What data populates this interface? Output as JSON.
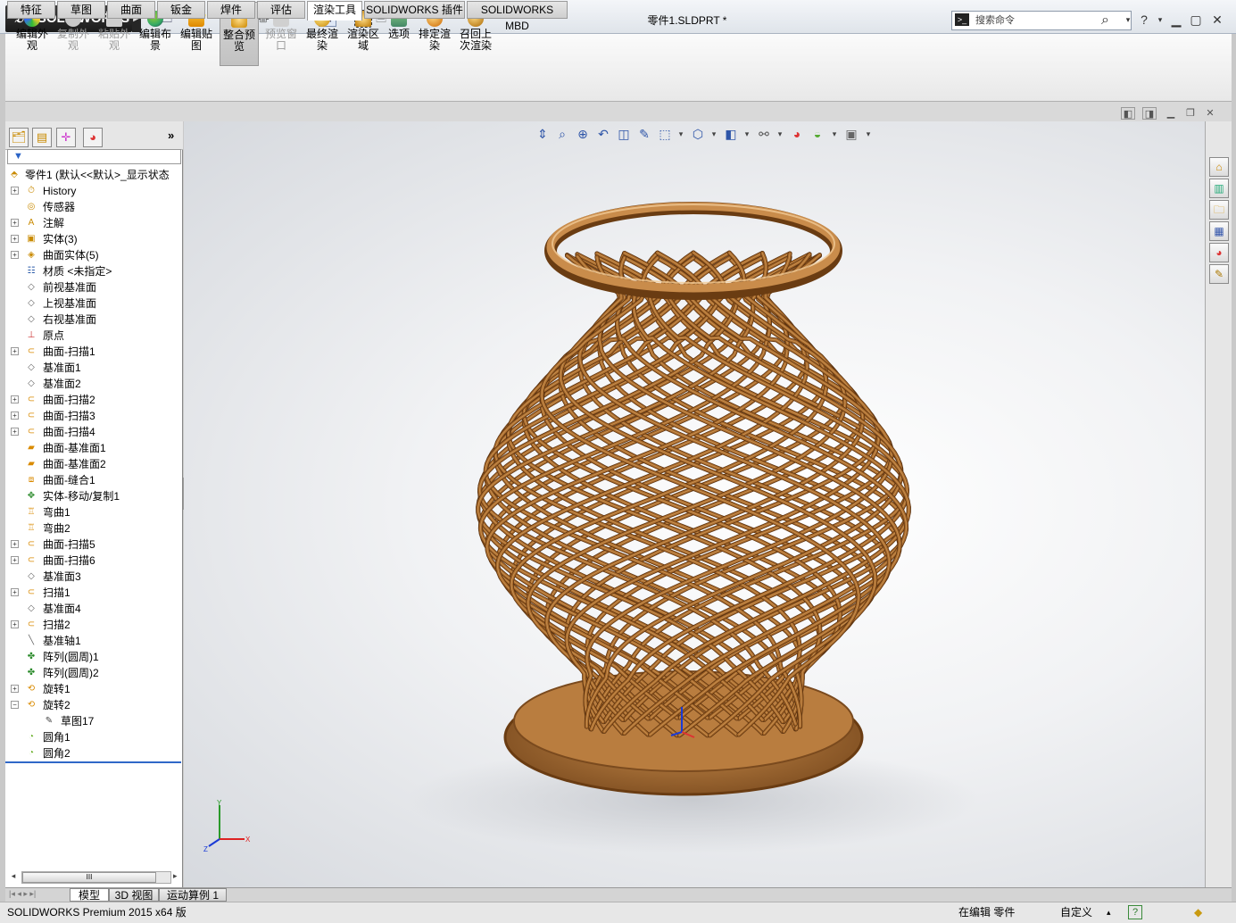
{
  "app": {
    "brand": "SOLIDWORKS",
    "document_title": "零件1.SLDPRT *"
  },
  "search": {
    "placeholder": "搜索命令"
  },
  "commands": [
    {
      "label": "编辑外观",
      "icon": "edit-appearance-icon",
      "enabled": true
    },
    {
      "label": "复制外观",
      "icon": "copy-appearance-icon",
      "enabled": false
    },
    {
      "label": "粘贴外观",
      "icon": "paste-appearance-icon",
      "enabled": false
    },
    {
      "label": "编辑布景",
      "icon": "edit-scene-icon",
      "enabled": true
    },
    {
      "label": "编辑贴图",
      "icon": "edit-decal-icon",
      "enabled": true
    },
    {
      "label": "整合预览",
      "icon": "integrated-preview-icon",
      "enabled": true,
      "active": true
    },
    {
      "label": "预览窗口",
      "icon": "preview-window-icon",
      "enabled": false
    },
    {
      "label": "最终渲染",
      "icon": "final-render-icon",
      "enabled": true
    },
    {
      "label": "渲染区域",
      "icon": "render-region-icon",
      "enabled": true
    },
    {
      "label": "选项",
      "icon": "options-icon",
      "enabled": true
    },
    {
      "label": "排定渲染",
      "icon": "schedule-render-icon",
      "enabled": true
    },
    {
      "label": "召回上次渲染",
      "icon": "recall-render-icon",
      "enabled": true
    }
  ],
  "tabs": [
    "特征",
    "草图",
    "曲面",
    "钣金",
    "焊件",
    "评估",
    "渲染工具",
    "SOLIDWORKS 插件",
    "SOLIDWORKS MBD"
  ],
  "selected_tab": "渲染工具",
  "tree": {
    "root": "零件1  (默认<<默认>_显示状态",
    "items": [
      {
        "label": "History",
        "icon": "history-icon",
        "expandable": true
      },
      {
        "label": "传感器",
        "icon": "sensor-icon",
        "expandable": false
      },
      {
        "label": "注解",
        "icon": "annotation-icon",
        "expandable": true
      },
      {
        "label": "实体(3)",
        "icon": "solid-bodies-icon",
        "expandable": true
      },
      {
        "label": "曲面实体(5)",
        "icon": "surface-bodies-icon",
        "expandable": true
      },
      {
        "label": "材质 <未指定>",
        "icon": "material-icon",
        "expandable": false
      },
      {
        "label": "前视基准面",
        "icon": "plane-icon",
        "expandable": false
      },
      {
        "label": "上视基准面",
        "icon": "plane-icon",
        "expandable": false
      },
      {
        "label": "右视基准面",
        "icon": "plane-icon",
        "expandable": false
      },
      {
        "label": "原点",
        "icon": "origin-icon",
        "expandable": false
      },
      {
        "label": "曲面-扫描1",
        "icon": "surface-sweep-icon",
        "expandable": true
      },
      {
        "label": "基准面1",
        "icon": "plane-icon",
        "expandable": false
      },
      {
        "label": "基准面2",
        "icon": "plane-icon",
        "expandable": false
      },
      {
        "label": "曲面-扫描2",
        "icon": "surface-sweep-icon",
        "expandable": true
      },
      {
        "label": "曲面-扫描3",
        "icon": "surface-sweep-icon",
        "expandable": true
      },
      {
        "label": "曲面-扫描4",
        "icon": "surface-sweep-icon",
        "expandable": true
      },
      {
        "label": "曲面-基准面1",
        "icon": "planar-surface-icon",
        "expandable": false
      },
      {
        "label": "曲面-基准面2",
        "icon": "planar-surface-icon",
        "expandable": false
      },
      {
        "label": "曲面-缝合1",
        "icon": "knit-surface-icon",
        "expandable": false
      },
      {
        "label": "实体-移动/复制1",
        "icon": "move-copy-icon",
        "expandable": false
      },
      {
        "label": "弯曲1",
        "icon": "flex-icon",
        "expandable": false
      },
      {
        "label": "弯曲2",
        "icon": "flex-icon",
        "expandable": false
      },
      {
        "label": "曲面-扫描5",
        "icon": "surface-sweep-icon",
        "expandable": true
      },
      {
        "label": "曲面-扫描6",
        "icon": "surface-sweep-icon",
        "expandable": true
      },
      {
        "label": "基准面3",
        "icon": "plane-icon",
        "expandable": false
      },
      {
        "label": "扫描1",
        "icon": "sweep-icon",
        "expandable": true
      },
      {
        "label": "基准面4",
        "icon": "plane-icon",
        "expandable": false
      },
      {
        "label": "扫描2",
        "icon": "sweep-icon",
        "expandable": true
      },
      {
        "label": "基准轴1",
        "icon": "axis-icon",
        "expandable": false
      },
      {
        "label": "阵列(圆周)1",
        "icon": "circular-pattern-icon",
        "expandable": false
      },
      {
        "label": "阵列(圆周)2",
        "icon": "circular-pattern-icon",
        "expandable": false
      },
      {
        "label": "旋转1",
        "icon": "revolve-icon",
        "expandable": true
      },
      {
        "label": "旋转2",
        "icon": "revolve-icon",
        "expandable": true,
        "expanded": true
      },
      {
        "label": "草图17",
        "icon": "sketch-icon",
        "expandable": false,
        "child": true
      },
      {
        "label": "圆角1",
        "icon": "fillet-icon",
        "expandable": false
      },
      {
        "label": "圆角2",
        "icon": "fillet-icon",
        "expandable": false
      }
    ]
  },
  "scroll_glyph": "III",
  "bottom_tabs": [
    "模型",
    "3D 视图",
    "运动算例 1"
  ],
  "status": {
    "product": "SOLIDWORKS Premium 2015 x64 版",
    "mode": "在编辑 零件",
    "units": "自定义",
    "help": "?"
  },
  "axes": {
    "x": "X",
    "y": "Y",
    "z": "Z"
  },
  "colors": {
    "accent": "#3068c8",
    "wood": "#a8692a",
    "wood_light": "#d9a86a",
    "wood_dark": "#6e3f14"
  }
}
